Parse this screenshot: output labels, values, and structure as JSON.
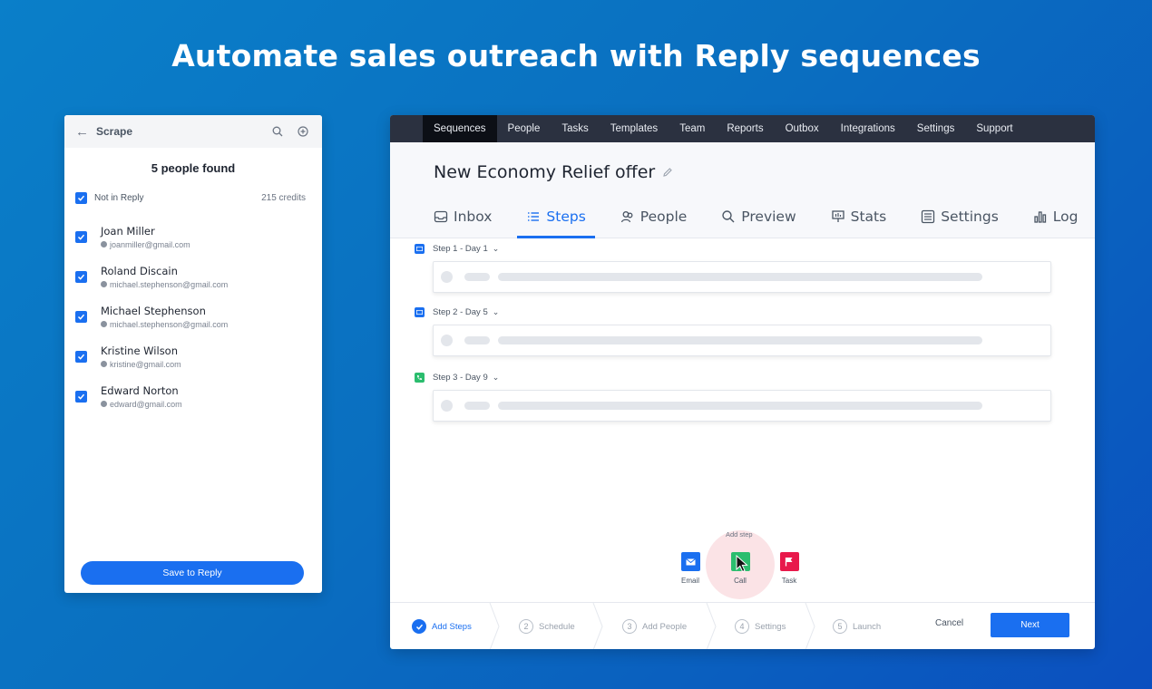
{
  "headline": "Automate sales outreach with Reply sequences",
  "scrape": {
    "title": "Scrape",
    "found_text": "5 people found",
    "filter_label": "Not in Reply",
    "credits": "215 credits",
    "people": [
      {
        "name": "Joan Miller",
        "email": "joanmiller@gmail.com"
      },
      {
        "name": "Roland Discain",
        "email": "michael.stephenson@gmail.com"
      },
      {
        "name": "Michael Stephenson",
        "email": "michael.stephenson@gmail.com"
      },
      {
        "name": "Kristine Wilson",
        "email": "kristine@gmail.com"
      },
      {
        "name": "Edward Norton",
        "email": "edward@gmail.com"
      }
    ],
    "save_button": "Save to Reply"
  },
  "app": {
    "nav": [
      "Sequences",
      "People",
      "Tasks",
      "Templates",
      "Team",
      "Reports",
      "Outbox",
      "Integrations",
      "Settings",
      "Support"
    ],
    "sequence_title": "New Economy Relief offer",
    "tabs": [
      "Inbox",
      "Steps",
      "People",
      "Preview",
      "Stats",
      "Settings",
      "Log"
    ],
    "steps": [
      {
        "label": "Step 1 - Day 1",
        "type": "email"
      },
      {
        "label": "Step 2 - Day 5",
        "type": "email"
      },
      {
        "label": "Step 3 - Day 9",
        "type": "call"
      }
    ],
    "add_step": {
      "label": "Add step",
      "options": [
        "Email",
        "Call",
        "Task"
      ]
    },
    "wizard": {
      "steps": [
        {
          "num": "1",
          "label": "Add Steps"
        },
        {
          "num": "2",
          "label": "Schedule"
        },
        {
          "num": "3",
          "label": "Add People"
        },
        {
          "num": "4",
          "label": "Settings"
        },
        {
          "num": "5",
          "label": "Launch"
        }
      ],
      "cancel": "Cancel",
      "next": "Next"
    }
  },
  "colors": {
    "accent": "#1a6ff0",
    "nav_bg": "#2b3140",
    "call_green": "#2bbd6e",
    "task_red": "#e8194b"
  }
}
